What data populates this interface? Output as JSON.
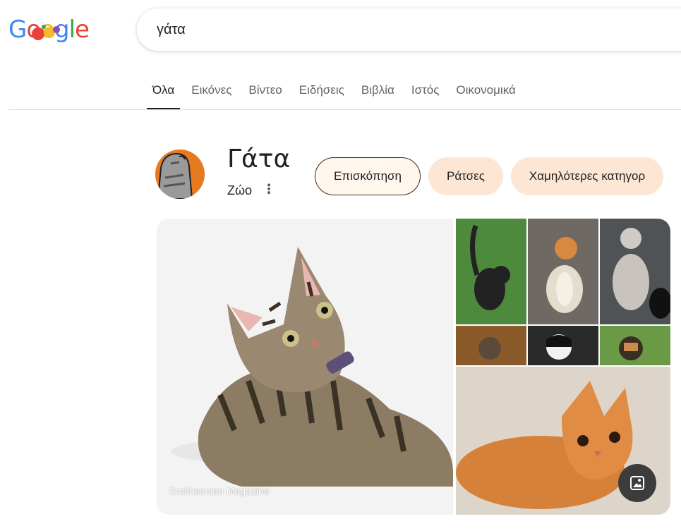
{
  "logo": {
    "letters": [
      "G",
      "o",
      "o",
      "g",
      "l",
      "e"
    ]
  },
  "search": {
    "query": "γάτα"
  },
  "tabs": [
    {
      "label": "Όλα",
      "active": true
    },
    {
      "label": "Εικόνες"
    },
    {
      "label": "Βίντεο"
    },
    {
      "label": "Ειδήσεις"
    },
    {
      "label": "Βιβλία"
    },
    {
      "label": "Ιστός"
    },
    {
      "label": "Οικονομικά"
    }
  ],
  "entity": {
    "title": "Γάτα",
    "subtitle": "Ζώο",
    "more_icon": "vertical-dots-icon"
  },
  "chips": [
    {
      "label": "Επισκόπηση",
      "selected": true
    },
    {
      "label": "Ράτσες"
    },
    {
      "label": "Χαμηλότερες κατηγορ"
    }
  ],
  "gallery": {
    "credit": "Smithsonian Magazine",
    "button_icon": "image-icon"
  },
  "colors": {
    "accent_chip": "#fde7d4",
    "selected_border": "#3c2a20",
    "avatar_bg": "#e67a21"
  }
}
